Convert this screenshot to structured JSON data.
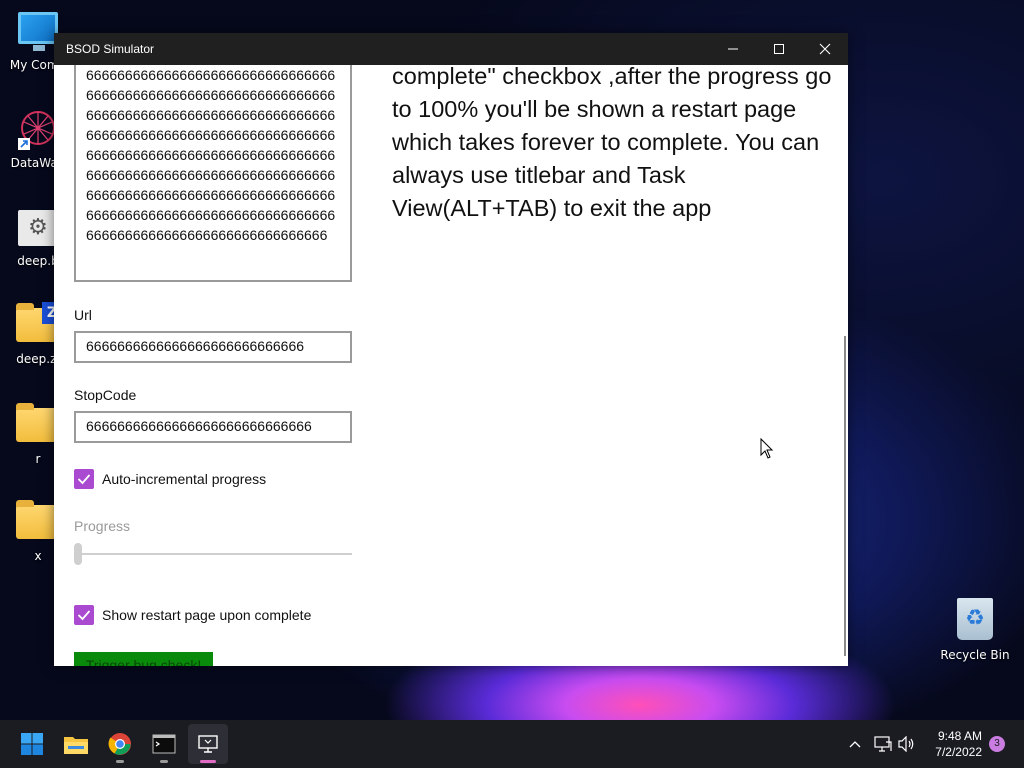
{
  "desktop": {
    "icons": [
      {
        "label": "My Comp"
      },
      {
        "label": "DataWag"
      },
      {
        "label": "deep.b"
      },
      {
        "label": "deep.zi"
      },
      {
        "label": "r"
      },
      {
        "label": "x"
      },
      {
        "label": "Recycle Bin"
      }
    ]
  },
  "window": {
    "title": "BSOD Simulator",
    "textarea_value": "66666666666666666666666666666666666666666666666666666666666666666666666666666666666666666666666666666666666666666666666666666666666666666666666666666666666666666666666666666666666666666666666666666666666666666666666666666666666666666666666666666666666666666666666666666666666666666666666",
    "url_label": "Url",
    "url_value": "6666666666666666666666666666",
    "stopcode_label": "StopCode",
    "stopcode_value": "66666666666666666666666666666",
    "auto_progress_label": "Auto-incremental progress",
    "auto_progress_checked": true,
    "progress_label": "Progress",
    "progress_value": 0,
    "show_restart_label": "Show restart page upon complete",
    "show_restart_checked": true,
    "trigger_button": "Trigger bug check!",
    "info_text": "you check the \"Show restart page upon complete\" checkbox ,after the progress go to 100% you'll be shown a restart page which takes forever to complete. You can always use titlebar and Task View(ALT+TAB) to exit the app"
  },
  "taskbar": {
    "apps": [
      "start-icon",
      "file-explorer-icon",
      "chrome-icon",
      "terminal-icon",
      "bsod-simulator-icon"
    ],
    "time": "9:48 AM",
    "date": "7/2/2022",
    "notification_count": "3"
  },
  "colors": {
    "accent_checkbox": "#a94ad0",
    "trigger_button_bg": "#0a8a0a",
    "titlebar_bg": "#202020",
    "taskbar_bg": "#1b1c22"
  }
}
